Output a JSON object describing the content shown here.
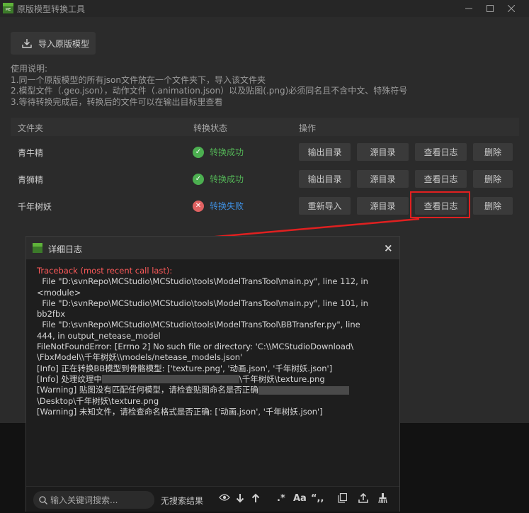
{
  "window": {
    "title": "原版模型转换工具",
    "icon_label": "ME"
  },
  "toolbar": {
    "import_label": "导入原版模型"
  },
  "instructions": [
    "使用说明:",
    "1.同一个原版模型的所有json文件放在一个文件夹下，导入该文件夹",
    "2.模型文件（.geo.json），动作文件（.animation.json）以及贴图(.png)必须同名且不含中文、特殊符号",
    "3.等待转换完成后，转换后的文件可以在输出目标里查看"
  ],
  "table": {
    "headers": {
      "folder": "文件夹",
      "status": "转换状态",
      "actions": "操作"
    },
    "rows": [
      {
        "name": "青牛精",
        "status": "转换成功",
        "state": "ok",
        "actions": [
          "输出目录",
          "源目录",
          "查看日志",
          "删除"
        ]
      },
      {
        "name": "青狮精",
        "status": "转换成功",
        "state": "ok",
        "actions": [
          "输出目录",
          "源目录",
          "查看日志",
          "删除"
        ]
      },
      {
        "name": "千年树妖",
        "status": "转换失败",
        "state": "fail",
        "actions": [
          "重新导入",
          "源目录",
          "查看日志",
          "删除"
        ]
      }
    ]
  },
  "log_dialog": {
    "title": "详细日志",
    "lines": [
      "Traceback (most recent call last):",
      "  File \"D:\\svnRepo\\MCStudio\\MCStudio\\tools\\ModelTransTool\\main.py\", line 112, in",
      "<module>",
      "  File \"D:\\svnRepo\\MCStudio\\MCStudio\\tools\\ModelTransTool\\main.py\", line 101, in",
      "bb2fbx",
      "  File \"D:\\svnRepo\\MCStudio\\MCStudio\\tools\\ModelTransTool\\BBTransfer.py\", line",
      "444, in output_netease_model",
      "FileNotFoundError: [Errno 2] No such file or directory: 'C:\\\\MCStudioDownload\\",
      "\\FbxModel\\\\千年树妖\\\\models/netease_models.json'",
      "[Info] 正在转换BB模型到骨骼模型: ['texture.png', '动画.json', '千年树妖.json']"
    ],
    "line_texture_prefix": "[Info] 处理纹理中",
    "line_texture_suffix": "\\千年树妖\\texture.png",
    "line_warn1_prefix": "[Warning] 贴图没有匹配任何模型，请检查贴图命名是否正确",
    "line_warn1_cont": "\\Desktop\\千年树妖\\texture.png",
    "line_warn2": "[Warning] 未知文件，请检查命名格式是否正确: ['动画.json', '千年树妖.json']",
    "search_placeholder": "输入关键词搜索...",
    "search_status": "无搜索结果",
    "case_label": "Aa",
    "regex_label": ".*",
    "quote_label": "“,,"
  },
  "colors": {
    "success": "#53b356",
    "failure_link": "#3f8fe0",
    "traceback": "#ff5a5a",
    "highlight": "#e02020"
  }
}
